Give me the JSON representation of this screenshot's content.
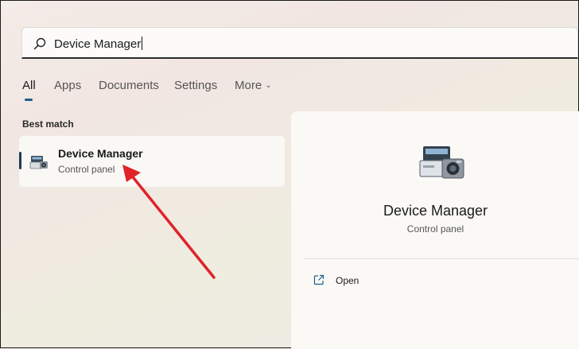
{
  "search": {
    "value": "Device Manager"
  },
  "tabs": [
    {
      "label": "All",
      "active": true
    },
    {
      "label": "Apps"
    },
    {
      "label": "Documents"
    },
    {
      "label": "Settings"
    },
    {
      "label": "More"
    }
  ],
  "best_match": {
    "heading": "Best match",
    "result": {
      "title": "Device Manager",
      "subtitle": "Control panel",
      "icon": "device-manager-icon"
    }
  },
  "detail": {
    "title": "Device Manager",
    "subtitle": "Control panel",
    "icon": "device-manager-icon",
    "actions": [
      {
        "label": "Open",
        "icon": "open-external-icon"
      }
    ]
  },
  "colors": {
    "accent": "#1b5e8a",
    "arrow": "#e0222a"
  }
}
